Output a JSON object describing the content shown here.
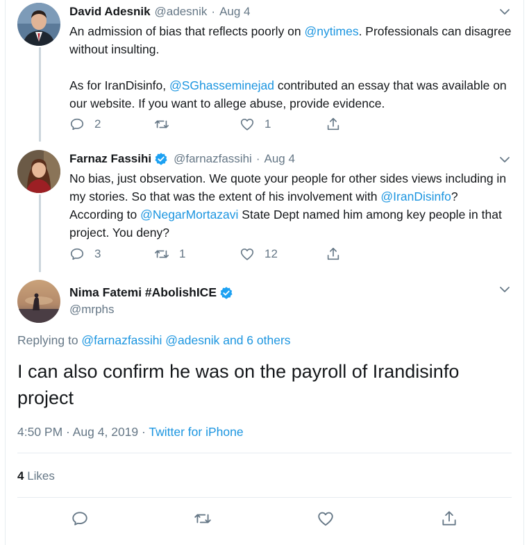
{
  "tweets": [
    {
      "name": "David Adesnik",
      "handle": "@adesnik",
      "date": "Aug 4",
      "verified": false,
      "text_p1_before": "An admission of bias that reflects poorly on ",
      "text_p1_mention": "@nytimes",
      "text_p1_after": ". Professionals can disagree without insulting.",
      "text_p2_before": "As for IranDisinfo, ",
      "text_p2_mention": "@SGhasseminejad",
      "text_p2_after": " contributed an essay that was available on our website. If you want to allege abuse, provide evidence.",
      "replies": "2",
      "retweets": "",
      "likes": "1"
    },
    {
      "name": "Farnaz Fassihi",
      "handle": "@farnazfassihi",
      "date": "Aug 4",
      "verified": true,
      "text_before": "No bias, just observation. We quote your people for other sides views including in my stories. So that was the extent of his involvement with ",
      "mention1": "@IranDisinfo",
      "text_middle": "? According to ",
      "mention2": "@NegarMortazavi",
      "text_after": " State Dept named him among key people in that project. You deny?",
      "replies": "3",
      "retweets": "1",
      "likes": "12"
    }
  ],
  "main": {
    "name": "Nima Fatemi #AbolishICE",
    "handle": "@mrphs",
    "verified": true,
    "replying_label": "Replying to ",
    "replying_mentions": "@farnazfassihi @adesnik and 6 others",
    "text": "I can also confirm he was on the payroll of Irandisinfo project",
    "time": "4:50 PM · Aug 4, 2019 · ",
    "source": "Twitter for iPhone",
    "likes_count": "4",
    "likes_label": " Likes"
  },
  "colors": {
    "accent": "#1b95e0",
    "secondary": "#657786",
    "verified": "#1da1f2",
    "divider": "#e6ecf0"
  },
  "icons": [
    "reply-icon",
    "retweet-icon",
    "like-icon",
    "share-icon",
    "chevron-down-icon",
    "verified-badge-icon"
  ]
}
